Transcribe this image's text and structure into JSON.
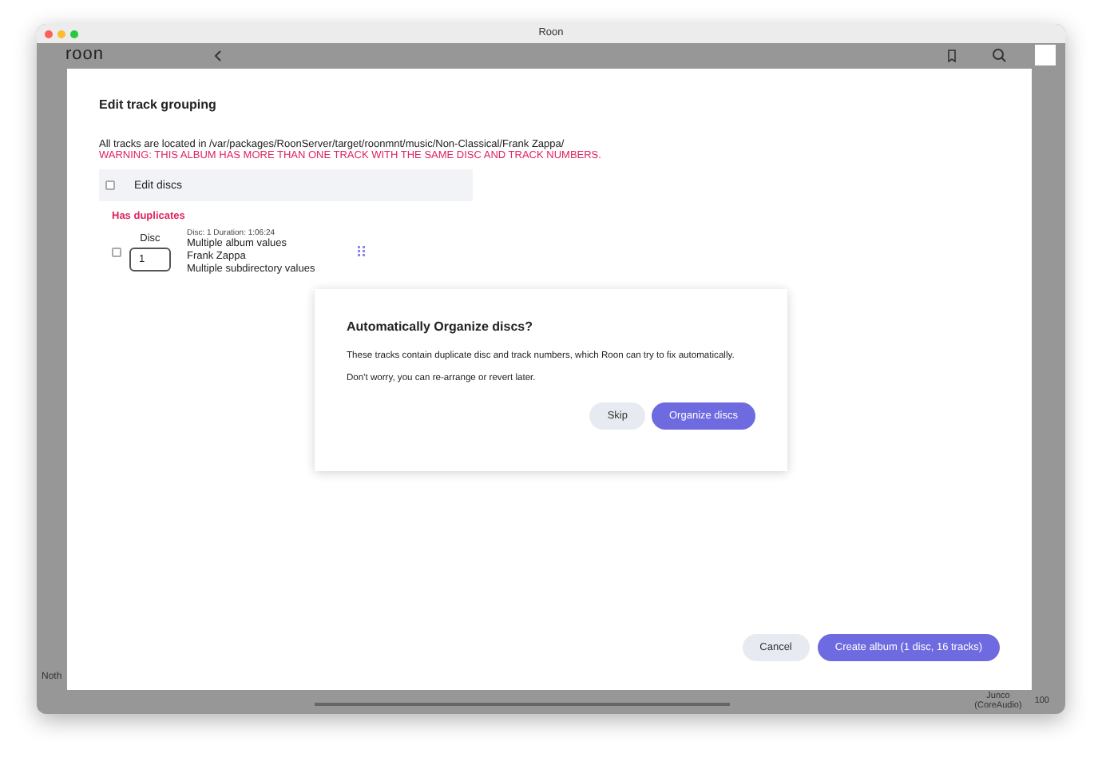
{
  "window": {
    "title": "Roon"
  },
  "app": {
    "logo": "roon",
    "bottom_left": "Noth",
    "zone": "Junco",
    "zone_sub": "(CoreAudio)",
    "volume": "100"
  },
  "editor": {
    "title": "Edit track grouping",
    "location": "All tracks are located in /var/packages/RoonServer/target/roonmnt/music/Non-Classical/Frank Zappa/",
    "warning": "WARNING: THIS ALBUM HAS MORE THAN ONE TRACK WITH THE SAME DISC AND TRACK NUMBERS.",
    "header": {
      "label": "Edit discs",
      "checked": false
    },
    "groups": [
      {
        "label": "Has duplicates",
        "rows": [
          {
            "checked": false,
            "disc_label": "Disc",
            "disc_value": "1",
            "meta": "Disc: 1   Duration: 1:06:24",
            "lines": [
              "Multiple album values",
              "Frank Zappa",
              "Multiple subdirectory values"
            ]
          }
        ]
      }
    ],
    "buttons": [
      {
        "label": "Cancel",
        "kind": "secondary"
      },
      {
        "label": "Create album (1 disc, 16 tracks)",
        "kind": "primary"
      }
    ]
  },
  "dialog": {
    "title": "Automatically Organize discs?",
    "paragraphs": [
      "These tracks contain duplicate disc and track numbers, which Roon can try to fix automatically.",
      "Don't worry, you can re-arrange or revert later."
    ],
    "buttons": [
      {
        "label": "Skip",
        "kind": "secondary"
      },
      {
        "label": "Organize discs",
        "kind": "primary"
      }
    ]
  }
}
